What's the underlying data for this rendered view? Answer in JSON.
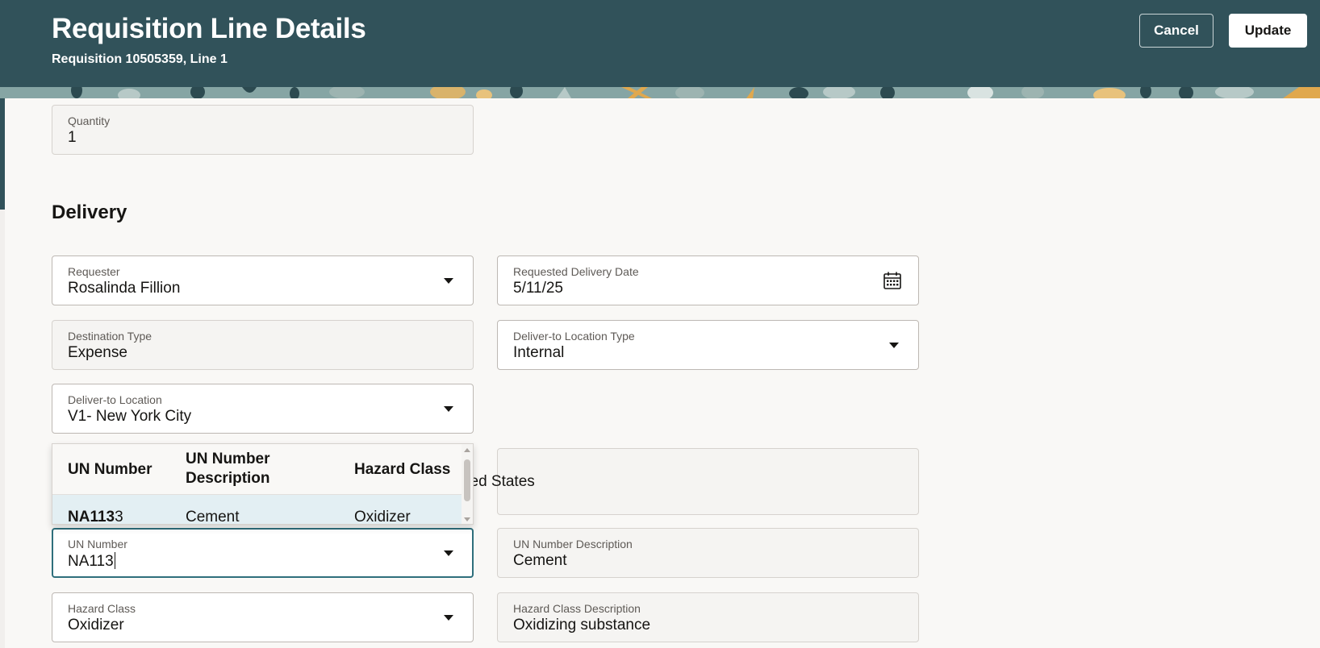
{
  "header": {
    "title": "Requisition Line Details",
    "subtitle": "Requisition 10505359, Line 1",
    "cancel_label": "Cancel",
    "update_label": "Update"
  },
  "quantity": {
    "label": "Quantity",
    "value": "1"
  },
  "delivery": {
    "section_title": "Delivery",
    "requester": {
      "label": "Requester",
      "value": "Rosalinda Fillion"
    },
    "requested_delivery_date": {
      "label": "Requested Delivery Date",
      "value": "5/11/25"
    },
    "destination_type": {
      "label": "Destination Type",
      "value": "Expense"
    },
    "deliver_to_location_type": {
      "label": "Deliver-to Location Type",
      "value": "Internal"
    },
    "deliver_to_location": {
      "label": "Deliver-to Location",
      "value": "V1- New York City"
    },
    "address_partial": "ited States",
    "un_number": {
      "label": "UN Number",
      "value": "NA113"
    },
    "un_number_description": {
      "label": "UN Number Description",
      "value": "Cement"
    },
    "hazard_class": {
      "label": "Hazard Class",
      "value": "Oxidizer"
    },
    "hazard_class_description": {
      "label": "Hazard Class Description",
      "value": "Oxidizing substance"
    }
  },
  "un_dropdown": {
    "columns": [
      "UN Number",
      "UN Number Description",
      "Hazard Class"
    ],
    "column_2_lines": [
      "UN Number",
      "Description"
    ],
    "rows": [
      {
        "un_match": "NA113",
        "un_rest": "3",
        "description": "Cement",
        "hazard_class": "Oxidizer"
      }
    ]
  },
  "icons": {
    "date": "calendar-icon",
    "select": "chevron-down-icon"
  },
  "colors": {
    "header_bg": "#31525a",
    "panel_bg": "#f9f8f6",
    "selected_row": "#e3eff3",
    "focus_border": "#2f6f7c"
  }
}
